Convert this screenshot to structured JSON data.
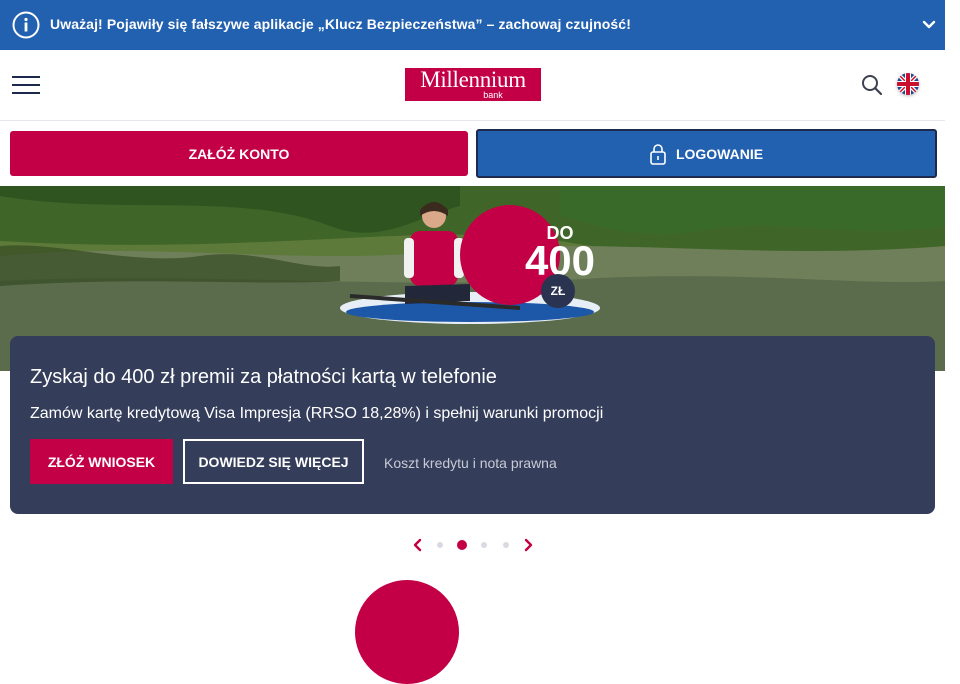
{
  "alert": {
    "text": "Uważaj! Pojawiły się fałszywe aplikacje „Klucz Bezpieczeństwa” – zachowaj czujność!",
    "icon": "info-icon",
    "toggle_icon": "chevron-down-icon"
  },
  "header": {
    "logo_word": "Millennium",
    "logo_sub": "bank",
    "menu_icon": "hamburger-icon",
    "search_icon": "search-icon",
    "language_icon": "uk-flag-icon"
  },
  "actions": {
    "open_account": "ZAŁÓŻ KONTO",
    "login": "LOGOWANIE",
    "login_icon": "lock-icon"
  },
  "hero": {
    "badge_prefix": "DO",
    "badge_value": "400",
    "badge_currency": "ZŁ"
  },
  "promo": {
    "title": "Zyskaj do 400 zł premii za płatności kartą w telefonie",
    "subtitle": "Zamów kartę kredytową Visa Impresja (RRSO 18,28%) i spełnij warunki promocji",
    "apply_button": "ZŁÓŻ WNIOSEK",
    "more_button": "DOWIEDZ SIĘ WIĘCEJ",
    "cost_link": "Koszt kredytu i nota prawna"
  },
  "carousel": {
    "slide_count": 4,
    "active_slide": 2
  },
  "colors": {
    "brand_crimson": "#c30045",
    "brand_blue": "#2260b0",
    "navy": "#343d5a"
  }
}
